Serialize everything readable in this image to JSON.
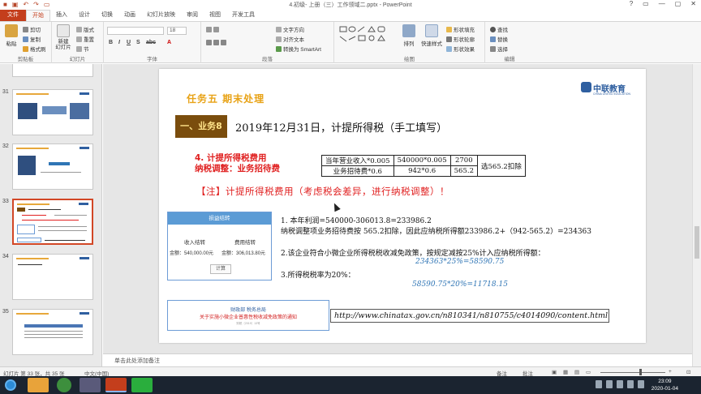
{
  "window": {
    "title": "4.初级- 上册（三）工作领域二.pptx - PowerPoint",
    "controls": [
      "?",
      "▭",
      "—",
      "▢",
      "✕"
    ]
  },
  "ribbon_tabs": [
    "文件",
    "开始",
    "插入",
    "设计",
    "切换",
    "动画",
    "幻灯片放映",
    "审阅",
    "视图",
    "开发工具"
  ],
  "ribbon": {
    "clipboard": {
      "label": "剪贴板",
      "paste": "粘贴",
      "cut": "剪切",
      "copy": "复制",
      "format_painter": "格式刷"
    },
    "slides": {
      "label": "幻灯片",
      "new_slide": "新建\n幻灯片",
      "layout": "版式",
      "reset": "重置",
      "section": "节"
    },
    "font": {
      "label": "字体",
      "font_name": "",
      "font_size": "18"
    },
    "paragraph": {
      "label": "段落",
      "text_direction": "文字方向",
      "align_text": "对齐文本",
      "smartart": "转换为 SmartArt"
    },
    "drawing": {
      "label": "绘图",
      "arrange": "排列",
      "quick_styles": "快速样式",
      "shape_fill": "形状填充",
      "shape_outline": "形状轮廓",
      "shape_effects": "形状效果"
    },
    "editing": {
      "label": "编辑",
      "find": "查找",
      "replace": "替换",
      "select": "选择"
    }
  },
  "thumbnails": [
    {
      "num": "31"
    },
    {
      "num": "32"
    },
    {
      "num": "33",
      "selected": true
    },
    {
      "num": "34"
    },
    {
      "num": "35"
    }
  ],
  "slide": {
    "task_title": "任务五   期末处理",
    "logo_name": "中联教育",
    "logo_sub": "CHINA UNITED EDUCATION",
    "badge": "一、业务8",
    "heading": "2019年12月31日，计提所得税（手工填写）",
    "red_label_1": "4. 计提所得税费用",
    "red_label_2": "纳税调整：业务招待费",
    "table": {
      "row1": [
        "当年营业收入*0.005",
        "540000*0.005",
        "2700"
      ],
      "row2": [
        "业务招待费*0.6",
        "942*0.6",
        "565.2"
      ],
      "merged": "选565.2扣除"
    },
    "note": "【注】计提所得税费用（考虑税会差异，进行纳税调整）！",
    "card": {
      "header": "损益结转",
      "income_label": "收入结转",
      "expense_label": "费用结转",
      "income_value": "金额：540,000.00元",
      "expense_value": "金额：306,013.80元",
      "button": "计算"
    },
    "line1": "1. 本年利润=540000-306013.8=233986.2",
    "line2": "纳税调整项业务招待费按 565.2扣除，因此应纳税所得额233986.2+（942-565.2）=234363",
    "line3": "2.该企业符合小微企业所得税税收减免政策，按规定减按25%计入应纳税所得额：",
    "calc1": "234363*25%=58590.75",
    "line4": "3.所得税税率为20%：",
    "calc2": "58590.75*20%=11718.15",
    "notice": {
      "line1": "财政部 税务总局",
      "line2": "关于实施小微企业普惠性税收减免政策的通知",
      "line3": "财税〔2019〕13号"
    },
    "url": "http://www.chinatax.gov.cn/n810341/n810755/c4014090/content.html"
  },
  "notes_placeholder": "单击此处添加备注",
  "status": {
    "slide_info": "幻灯片 第 33 张，共 35 张",
    "language": "中文(中国)",
    "notes": "备注",
    "comments": "批注",
    "zoom": "+"
  },
  "taskbar": {
    "time": "23:09",
    "date": "2020-01-04"
  }
}
